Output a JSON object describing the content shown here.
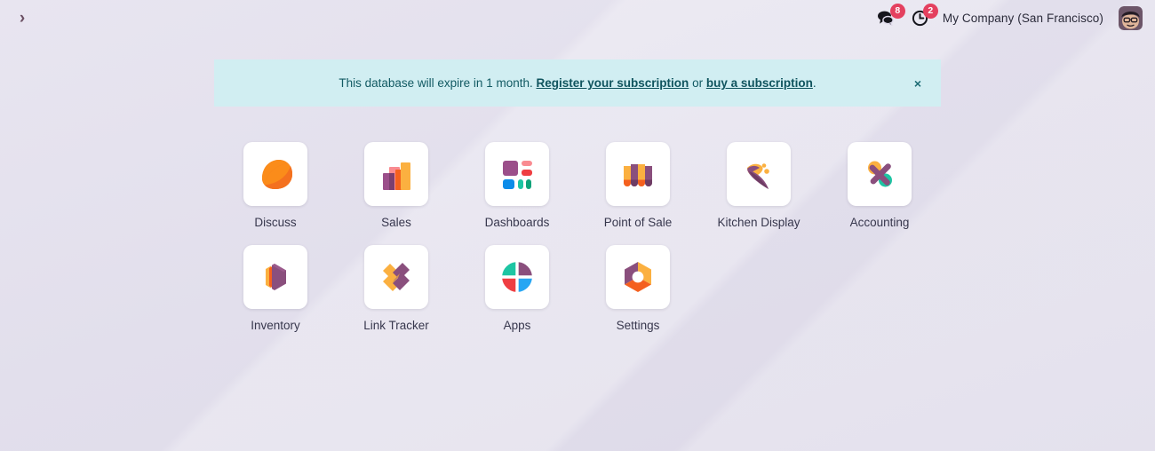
{
  "topbar": {
    "sidebar_toggle_label": "›",
    "messages": {
      "icon": "speech-bubbles-icon",
      "count": "8"
    },
    "activities": {
      "icon": "clock-activity-icon",
      "count": "2"
    },
    "company": "My Company (San Francisco)",
    "avatar_alt": "user-avatar"
  },
  "banner": {
    "message_before": "This database will expire in 1 month.",
    "link_register": "Register your subscription",
    "middle": "or",
    "link_buy": "buy a subscription",
    "period": ".",
    "close_label": "×",
    "background": "#d1eef2",
    "text_color": "#125a63"
  },
  "apps": [
    {
      "name": "Discuss",
      "icon": "discuss-icon"
    },
    {
      "name": "Sales",
      "icon": "sales-icon"
    },
    {
      "name": "Dashboards",
      "icon": "dashboards-icon"
    },
    {
      "name": "Point of Sale",
      "icon": "point-of-sale-icon"
    },
    {
      "name": "Kitchen Display",
      "icon": "kitchen-display-icon"
    },
    {
      "name": "Accounting",
      "icon": "accounting-icon"
    },
    {
      "name": "Inventory",
      "icon": "inventory-icon"
    },
    {
      "name": "Link Tracker",
      "icon": "link-tracker-icon"
    },
    {
      "name": "Apps",
      "icon": "apps-icon"
    },
    {
      "name": "Settings",
      "icon": "settings-icon"
    }
  ],
  "colors": {
    "badge": "#e4405f",
    "page_bg": "#e3e0ec",
    "tile_bg": "#ffffff",
    "label": "#37374d",
    "orange": "#f97316",
    "amber": "#fbb040",
    "purple": "#8a4f7d",
    "teal": "#1dc5a3",
    "blue": "#0c8ce9",
    "red": "#ef3e42",
    "pink": "#f98b91"
  }
}
